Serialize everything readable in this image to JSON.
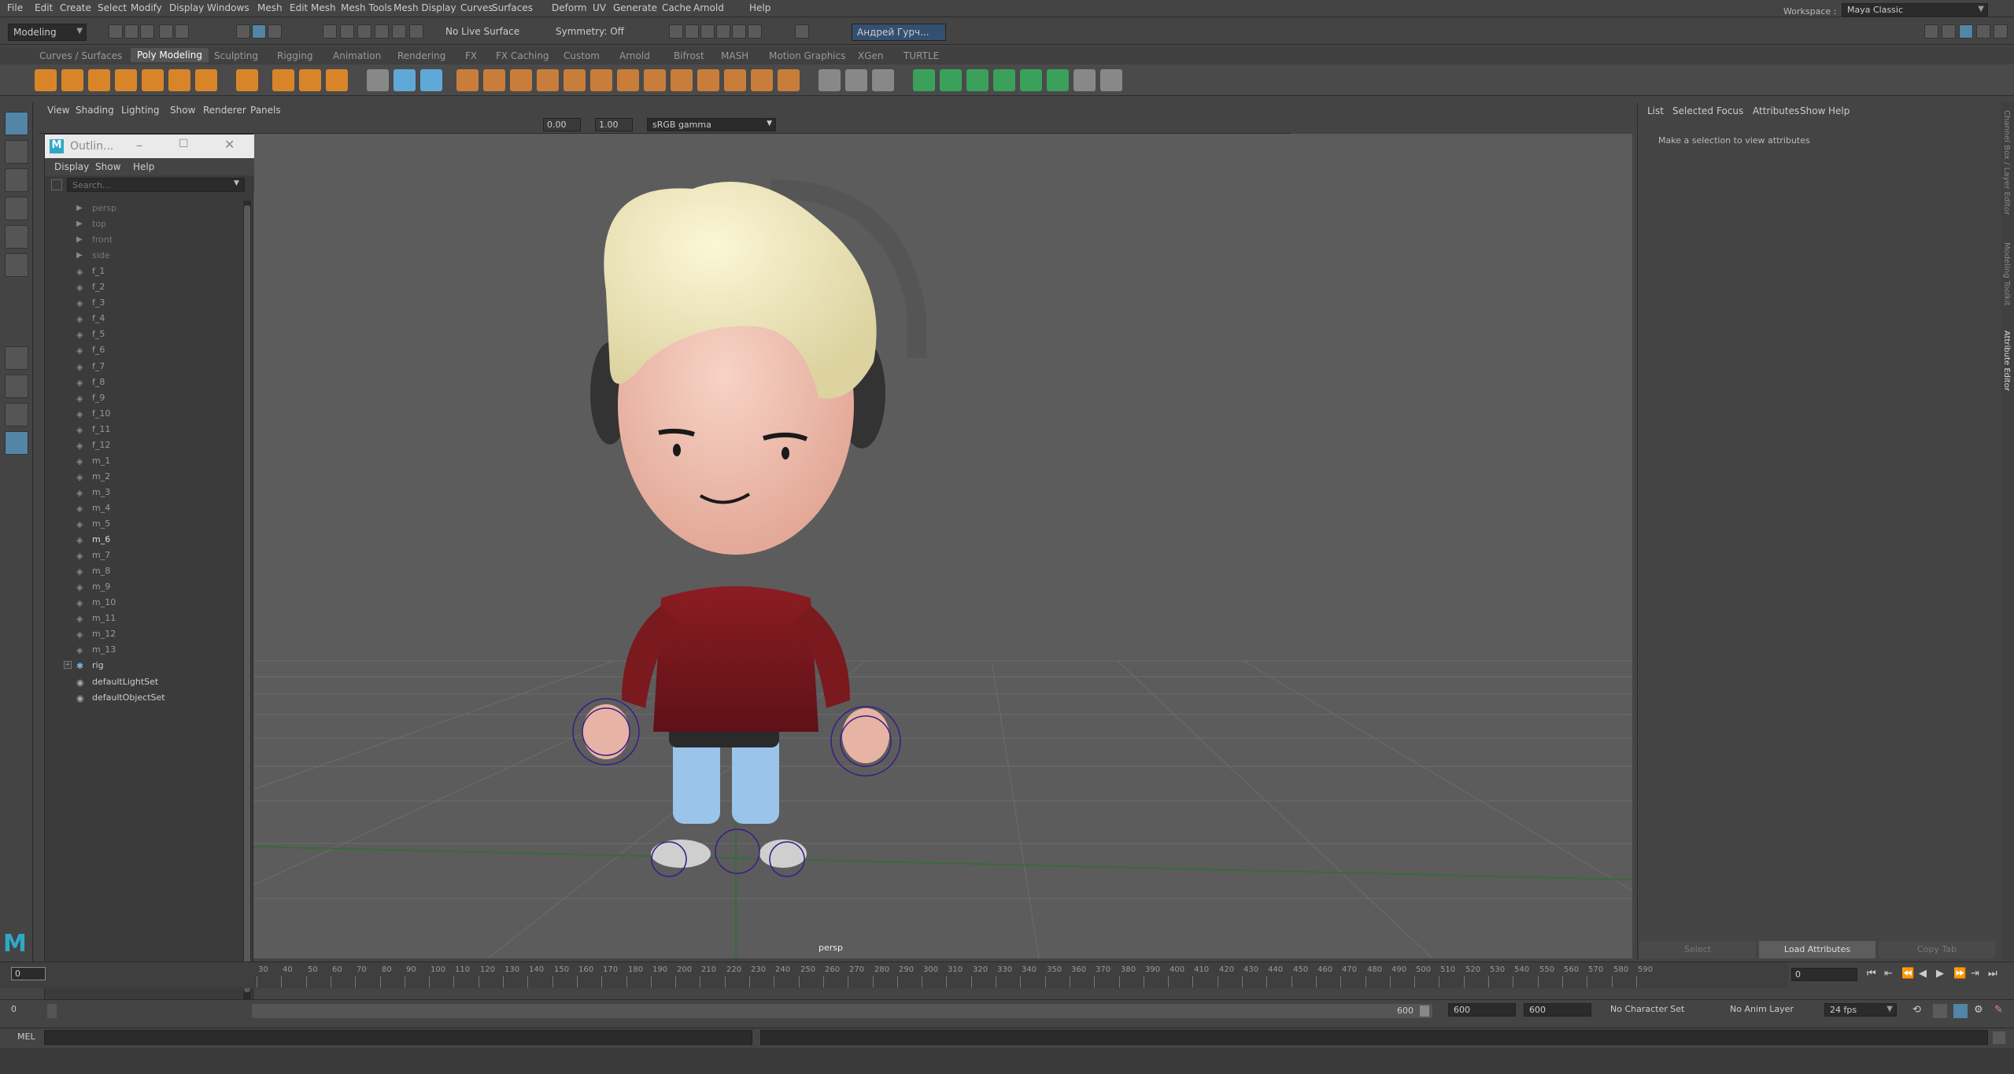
{
  "menubar": {
    "items": [
      "File",
      "Edit",
      "Create",
      "Select",
      "Modify",
      "Display",
      "Windows",
      "Mesh",
      "Edit Mesh",
      "Mesh Tools",
      "Mesh Display",
      "Curves",
      "Surfaces",
      "Deform",
      "UV",
      "Generate",
      "Cache",
      "Arnold",
      "Help"
    ],
    "workspace_label": "Workspace :",
    "workspace_value": "Maya Classic"
  },
  "statusline": {
    "mode": "Modeling",
    "live_surface": "No Live Surface",
    "symmetry": "Symmetry: Off",
    "user": "Андрей Гурч..."
  },
  "shelf": {
    "tabs": [
      "Curves / Surfaces",
      "Poly Modeling",
      "Sculpting",
      "Rigging",
      "Animation",
      "Rendering",
      "FX",
      "FX Caching",
      "Custom",
      "Arnold",
      "Bifrost",
      "MASH",
      "Motion Graphics",
      "XGen",
      "TURTLE"
    ],
    "active_tab": "Poly Modeling"
  },
  "viewport": {
    "menu": [
      "View",
      "Shading",
      "Lighting",
      "Show",
      "Renderer",
      "Panels"
    ],
    "exposure": "0.00",
    "gamma": "1.00",
    "color_space": "sRGB gamma",
    "camera_label": "persp"
  },
  "outliner": {
    "title": "Outlin...",
    "menu": [
      "Display",
      "Show",
      "Help"
    ],
    "search_placeholder": "Search...",
    "items": [
      {
        "label": "persp",
        "type": "camera"
      },
      {
        "label": "top",
        "type": "camera"
      },
      {
        "label": "front",
        "type": "camera"
      },
      {
        "label": "side",
        "type": "camera"
      },
      {
        "label": "f_1",
        "type": "mesh"
      },
      {
        "label": "f_2",
        "type": "mesh"
      },
      {
        "label": "f_3",
        "type": "mesh"
      },
      {
        "label": "f_4",
        "type": "mesh"
      },
      {
        "label": "f_5",
        "type": "mesh"
      },
      {
        "label": "f_6",
        "type": "mesh"
      },
      {
        "label": "f_7",
        "type": "mesh"
      },
      {
        "label": "f_8",
        "type": "mesh"
      },
      {
        "label": "f_9",
        "type": "mesh"
      },
      {
        "label": "f_10",
        "type": "mesh"
      },
      {
        "label": "f_11",
        "type": "mesh"
      },
      {
        "label": "f_12",
        "type": "mesh"
      },
      {
        "label": "m_1",
        "type": "mesh"
      },
      {
        "label": "m_2",
        "type": "mesh"
      },
      {
        "label": "m_3",
        "type": "mesh"
      },
      {
        "label": "m_4",
        "type": "mesh"
      },
      {
        "label": "m_5",
        "type": "mesh"
      },
      {
        "label": "m_6",
        "type": "mesh"
      },
      {
        "label": "m_7",
        "type": "mesh"
      },
      {
        "label": "m_8",
        "type": "mesh"
      },
      {
        "label": "m_9",
        "type": "mesh"
      },
      {
        "label": "m_10",
        "type": "mesh"
      },
      {
        "label": "m_11",
        "type": "mesh"
      },
      {
        "label": "m_12",
        "type": "mesh"
      },
      {
        "label": "m_13",
        "type": "mesh"
      },
      {
        "label": "rig",
        "type": "joint"
      },
      {
        "label": "defaultLightSet",
        "type": "set"
      },
      {
        "label": "defaultObjectSet",
        "type": "set"
      }
    ]
  },
  "attribute_editor": {
    "menu": [
      "List",
      "Selected",
      "Focus",
      "Attributes",
      "Show",
      "Help"
    ],
    "message": "Make a selection to view attributes",
    "buttons": [
      "Select",
      "Load Attributes",
      "Copy Tab"
    ]
  },
  "side_tabs": [
    "Channel Box / Layer Editor",
    "Modeling Toolkit",
    "Attribute Editor"
  ],
  "timeline": {
    "ticks": [
      "30",
      "40",
      "50",
      "60",
      "70",
      "80",
      "90",
      "100",
      "110",
      "120",
      "130",
      "140",
      "150",
      "160",
      "170",
      "180",
      "190",
      "200",
      "210",
      "220",
      "230",
      "240",
      "250",
      "260",
      "270",
      "280",
      "290",
      "300",
      "310",
      "320",
      "330",
      "340",
      "350",
      "360",
      "370",
      "380",
      "390",
      "400",
      "410",
      "420",
      "430",
      "440",
      "450",
      "460",
      "470",
      "480",
      "490",
      "500",
      "510",
      "520",
      "530",
      "540",
      "550",
      "560",
      "570",
      "580",
      "590"
    ],
    "current_frame": "0",
    "current_frame_right": "0"
  },
  "range": {
    "start": "0",
    "range_end_label": "600",
    "end_a": "600",
    "end_b": "600",
    "character_set": "No Character Set",
    "anim_layer": "No Anim Layer",
    "fps": "24 fps"
  },
  "cmdline": {
    "lang": "MEL"
  }
}
